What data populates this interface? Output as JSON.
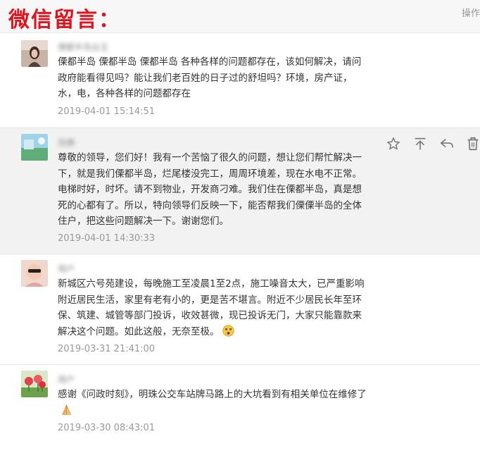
{
  "header": {
    "title": "微信留言：",
    "ops_label": "操作"
  },
  "comments": [
    {
      "nickname": "傈都半岛业主",
      "text": "傈都半岛 傈都半岛 傈都半岛 各种各样的问题都存在，该如何解决，请问政府能看得见吗？能让我们老百姓的日子过的舒坦吗？环境，房产证，水，电，各种各样的问题都存在",
      "time": "2019-04-01 15:14:51"
    },
    {
      "nickname": "月牌",
      "text": "尊敬的领导，您们好！我有一个苦恼了很久的问题，想让您们帮忙解决一下，就是我们傈都半岛，烂尾楼没完工，周周环境差，现在水电不正常。电梯时好，时坏。请不到物业，开发商刁难。我们住在傈都半岛，真是想死的心都有了。所以，特向领导们反映一下，能否帮我们傈傈半岛的全体住户，把这些问题解决一下。谢谢您们。",
      "time": "2019-04-01 14:30:33"
    },
    {
      "nickname": "用户",
      "text": "新城区六号苑建设，每晚施工至凌晨1至2点，施工噪音太大，已严重影响附近居民生活，家里有老有小的，更是苦不堪言。附近不少居民长年至环保、筑建、城管等部门投诉，收效甚微，现已投诉无门，大家只能靠款来解决这个问题。如此这般，无奈至极。",
      "time": "2019-03-31 21:41:00"
    },
    {
      "nickname": "用户",
      "text": "感谢《问政时刻》，明珠公交车站牌马路上的大坑看到有相关单位在维修了",
      "time": "2019-03-30 08:43:01"
    }
  ],
  "icons": {
    "star": "star-icon",
    "top": "pin-top-icon",
    "reply": "reply-icon",
    "delete": "trash-icon",
    "dizzy_emoji": "dizzy-face-emoji",
    "pray_emoji": "pray-hands-emoji"
  },
  "colors": {
    "title_red": "#e0141e",
    "hover_bg": "#f2f2f2",
    "time_gray": "#999999"
  }
}
